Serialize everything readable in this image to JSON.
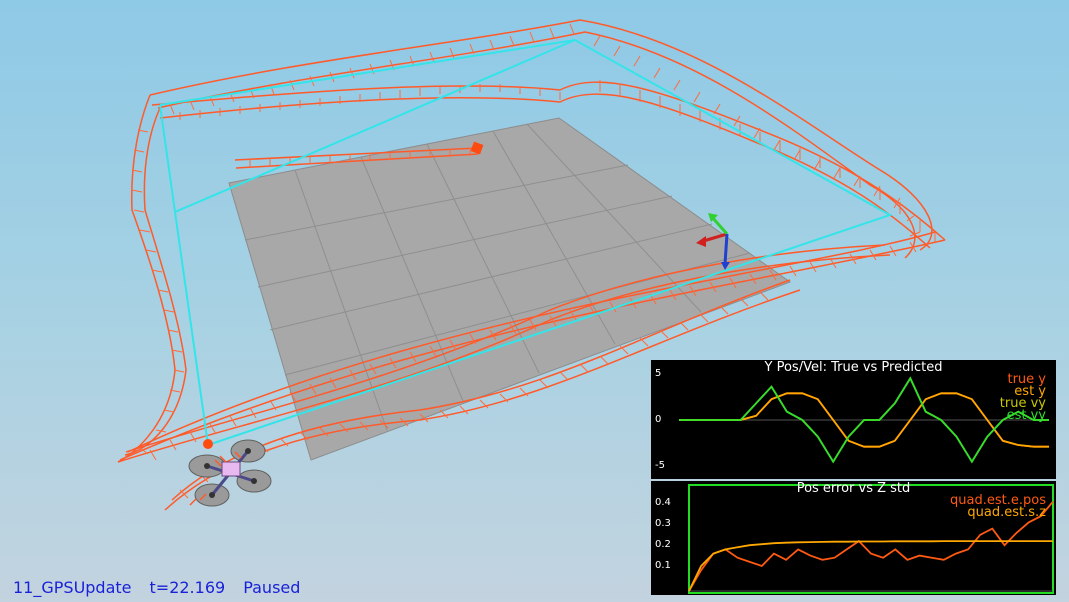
{
  "status_bar": {
    "scenario": "11_GPSUpdate",
    "time": "t=22.169",
    "state": "Paused"
  },
  "plot_top": {
    "title": "Y Pos/Vel: True vs Predicted",
    "y_ticks": [
      "5",
      "0",
      "-5"
    ],
    "legend": [
      {
        "label": "true y",
        "color": "#ff5a12"
      },
      {
        "label": "est y",
        "color": "#ffa800"
      },
      {
        "label": "true vy",
        "color": "#c8c800"
      },
      {
        "label": "est vy",
        "color": "#2ee02e"
      }
    ]
  },
  "plot_bottom": {
    "title": "Pos error vs Z std",
    "y_ticks": [
      "0.4",
      "0.3",
      "0.2",
      "0.1"
    ],
    "border_color": "#22dd22",
    "legend": [
      {
        "label": "quad.est.e.pos",
        "color": "#ff5a12"
      },
      {
        "label": "quad.est.s.z",
        "color": "#ffa800"
      }
    ]
  },
  "colors": {
    "trajectory": "#ff5a2a",
    "waypoint_path": "#33e4e8",
    "ground": "#a8a8a8"
  },
  "chart_data": [
    {
      "type": "line",
      "title": "Y Pos/Vel: True vs Predicted",
      "ylim": [
        -6,
        6
      ],
      "series": [
        {
          "name": "true y",
          "values": [
            0,
            0,
            0,
            0,
            0,
            0.5,
            2.5,
            3.2,
            3.2,
            2.5,
            0,
            -2.5,
            -3.2,
            -3.2,
            -2.5,
            0,
            2.5,
            3.2,
            3.2,
            2.5,
            0,
            -2.5,
            -3,
            -3.2,
            -3.2
          ]
        },
        {
          "name": "est y",
          "values": [
            0,
            0,
            0,
            0,
            0,
            0.5,
            2.5,
            3.2,
            3.2,
            2.5,
            0,
            -2.5,
            -3.2,
            -3.2,
            -2.5,
            0,
            2.5,
            3.2,
            3.2,
            2.5,
            0,
            -2.5,
            -3,
            -3.2,
            -3.2
          ]
        },
        {
          "name": "true vy",
          "values": [
            0,
            0,
            0,
            0,
            0,
            2,
            4,
            1,
            0,
            -2,
            -5,
            -2,
            0,
            0,
            2,
            5,
            1,
            0,
            -2,
            -5,
            -2,
            0,
            1,
            0,
            0
          ]
        },
        {
          "name": "est vy",
          "values": [
            0,
            0,
            0,
            0,
            0,
            2,
            4,
            1,
            0,
            -2,
            -5,
            -2,
            0,
            0,
            2,
            5,
            1,
            0,
            -2,
            -5,
            -2,
            0,
            1,
            0,
            0
          ]
        }
      ]
    },
    {
      "type": "line",
      "title": "Pos error vs Z std",
      "ylim": [
        0,
        0.5
      ],
      "series": [
        {
          "name": "quad.est.e.pos",
          "values": [
            0,
            0.1,
            0.18,
            0.2,
            0.16,
            0.14,
            0.12,
            0.18,
            0.15,
            0.2,
            0.17,
            0.15,
            0.16,
            0.2,
            0.24,
            0.18,
            0.16,
            0.2,
            0.15,
            0.17,
            0.16,
            0.15,
            0.18,
            0.2,
            0.27,
            0.3,
            0.22,
            0.28,
            0.33,
            0.36,
            0.43
          ]
        },
        {
          "name": "quad.est.s.z",
          "values": [
            0,
            0.12,
            0.18,
            0.2,
            0.21,
            0.22,
            0.225,
            0.23,
            0.232,
            0.234,
            0.235,
            0.236,
            0.237,
            0.237,
            0.238,
            0.238,
            0.238,
            0.239,
            0.239,
            0.239,
            0.239,
            0.24,
            0.24,
            0.24,
            0.24,
            0.24,
            0.24,
            0.24,
            0.24,
            0.24,
            0.24
          ]
        }
      ]
    }
  ]
}
